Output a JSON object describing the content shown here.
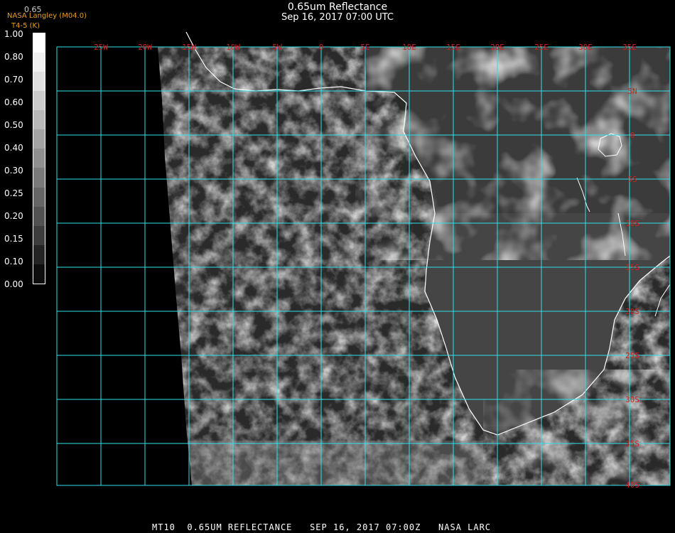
{
  "header": {
    "title": "0.65um Reflectance",
    "subtitle": "Sep 16, 2017 07:00 UTC",
    "credit": "NASA Langley (M04.0)",
    "credit_line2": "T4-5 (K)",
    "tiny_label": "0.65"
  },
  "colorbar": {
    "labels": [
      "1.00",
      "0.80",
      "0.70",
      "0.60",
      "0.50",
      "0.40",
      "0.30",
      "0.25",
      "0.20",
      "0.15",
      "0.10",
      "0.00"
    ],
    "shades": [
      "#ffffff",
      "#f0f0f0",
      "#e0e0e0",
      "#cccccc",
      "#b8b8b8",
      "#a3a3a3",
      "#8f8f8f",
      "#7a7a7a",
      "#666666",
      "#525252",
      "#3d3d3d",
      "#242424",
      "#0d0d0d"
    ]
  },
  "map": {
    "lon_labels": [
      "25W",
      "20W",
      "15W",
      "10W",
      "5W",
      "0",
      "5E",
      "10E",
      "15E",
      "20E",
      "25E",
      "30E",
      "35E"
    ],
    "lat_labels": [
      "5N",
      "0",
      "5S",
      "10S",
      "15S",
      "20S",
      "25S",
      "30S",
      "35S",
      "40S"
    ],
    "grid_color": "#2ee0e8",
    "label_color": "#d02020"
  },
  "footer": {
    "text": "MT10  0.65UM REFLECTANCE   SEP 16, 2017 07:00Z   NASA LARC"
  }
}
